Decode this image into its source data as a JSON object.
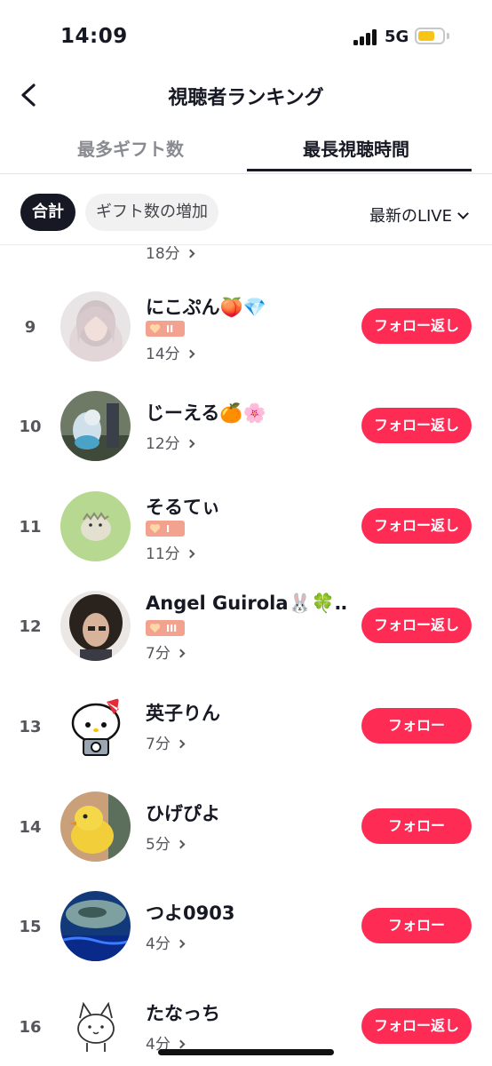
{
  "status": {
    "time": "14:09",
    "network": "5G",
    "battery_color": "#f7c518"
  },
  "nav": {
    "title": "視聴者ランキング",
    "back_icon": "chevron-left-icon"
  },
  "tabs": [
    {
      "label": "最多ギフト数",
      "active": false
    },
    {
      "label": "最長視聴時間",
      "active": true
    }
  ],
  "filters": {
    "chips": [
      {
        "label": "合計",
        "active": true
      },
      {
        "label": "ギフト数の増加",
        "active": false
      }
    ],
    "live_select": "最新のLIVE"
  },
  "partial_row": {
    "duration": "18分"
  },
  "viewers": [
    {
      "rank": "9",
      "name": "にこぷん🍑💎",
      "badge": "II",
      "duration": "14分",
      "button": "フォロー返し"
    },
    {
      "rank": "10",
      "name": "じーえる🍊🌸",
      "badge": null,
      "duration": "12分",
      "button": "フォロー返し"
    },
    {
      "rank": "11",
      "name": "そるてぃ",
      "badge": "I",
      "duration": "11分",
      "button": "フォロー返し"
    },
    {
      "rank": "12",
      "name": "Angel Guirola🐰🍀…",
      "badge": "III",
      "duration": "7分",
      "button": "フォロー返し"
    },
    {
      "rank": "13",
      "name": "英子りん",
      "badge": null,
      "duration": "7分",
      "button": "フォロー"
    },
    {
      "rank": "14",
      "name": "ひげぴよ",
      "badge": null,
      "duration": "5分",
      "button": "フォロー"
    },
    {
      "rank": "15",
      "name": "つよ0903",
      "badge": null,
      "duration": "4分",
      "button": "フォロー"
    },
    {
      "rank": "16",
      "name": "たなっち",
      "badge": null,
      "duration": "4分",
      "button": "フォロー返し"
    }
  ],
  "colors": {
    "accent": "#fe2c55",
    "badge": "#f2a28e",
    "text": "#161823",
    "muted": "#8a8b91"
  }
}
